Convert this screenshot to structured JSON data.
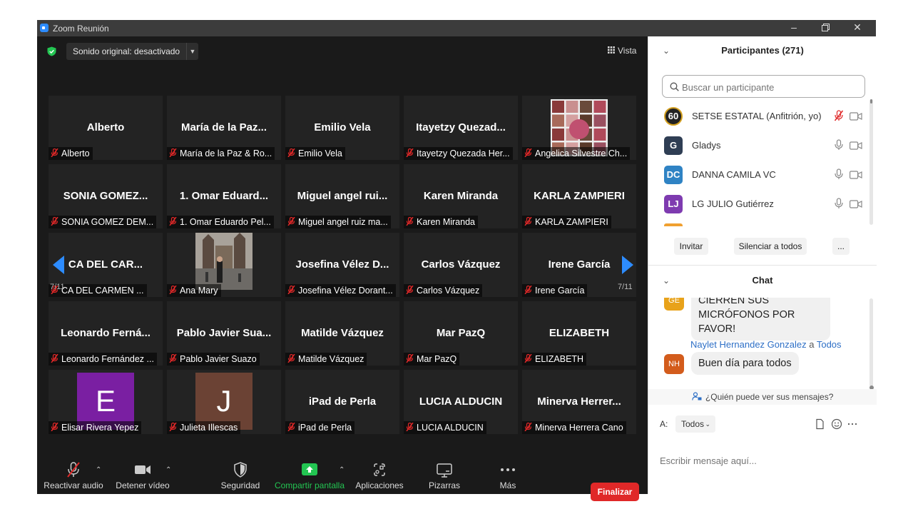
{
  "window": {
    "title": "Zoom Reunión"
  },
  "header": {
    "audio_label": "Sonido original: desactivado",
    "view_label": "Vista"
  },
  "grid": {
    "rows": [
      [
        {
          "name": "Alberto",
          "label": "Alberto"
        },
        {
          "name": "María de la Paz...",
          "label": "María de la Paz & Ro..."
        },
        {
          "name": "Emilio Vela",
          "label": "Emilio Vela"
        },
        {
          "name": "Itayetzy  Quezad...",
          "label": "Itayetzy Quezada Her..."
        },
        {
          "name": "",
          "label": "Angelica Silvestre Ch...",
          "media": "photo-collage"
        }
      ],
      [
        {
          "name": "SONIA  GOMEZ...",
          "label": "SONIA GOMEZ DEM..."
        },
        {
          "name": "1. Omar  Eduard...",
          "label": "1. Omar Eduardo Pel..."
        },
        {
          "name": "Miguel angel rui...",
          "label": "Miguel angel ruiz ma..."
        },
        {
          "name": "Karen Miranda",
          "label": "Karen Miranda"
        },
        {
          "name": "KARLA ZAMPIERI",
          "label": "KARLA ZAMPIERI"
        }
      ],
      [
        {
          "name": "CA DEL CAR...",
          "label": "CA DEL CARMEN ..."
        },
        {
          "name": "",
          "label": "Ana Mary",
          "media": "photo-street"
        },
        {
          "name": "Josefina Vélez D...",
          "label": "Josefina Vélez Dorant..."
        },
        {
          "name": "Carlos Vázquez",
          "label": "Carlos Vázquez"
        },
        {
          "name": "Irene García",
          "label": "Irene García"
        }
      ],
      [
        {
          "name": "Leonardo  Ferná...",
          "label": "Leonardo Fernández ..."
        },
        {
          "name": "Pablo Javier Sua...",
          "label": "Pablo Javier Suazo"
        },
        {
          "name": "Matilde Vázquez",
          "label": "Matilde Vázquez"
        },
        {
          "name": "Mar PazQ",
          "label": "Mar PazQ"
        },
        {
          "name": "ELIZABETH",
          "label": "ELIZABETH"
        }
      ],
      [
        {
          "name": "",
          "label": "Elisar Rivera Yepez",
          "avatar": "E",
          "avatar_color": "#7a1fa2"
        },
        {
          "name": "",
          "label": "Julieta Illescas",
          "avatar": "J",
          "avatar_color": "#6b4234"
        },
        {
          "name": "iPad de Perla",
          "label": "iPad de Perla"
        },
        {
          "name": "LUCIA ALDUCIN",
          "label": "LUCIA ALDUCIN"
        },
        {
          "name": "Minerva  Herrer...",
          "label": "Minerva Herrera Cano"
        }
      ]
    ],
    "page_left": "7/11",
    "page_right": "7/11"
  },
  "toolbar": {
    "unmute": "Reactivar audio",
    "stop_video": "Detener vídeo",
    "security": "Seguridad",
    "share": "Compartir pantalla",
    "apps": "Aplicaciones",
    "whiteboard": "Pizarras",
    "more": "Más",
    "end": "Finalizar"
  },
  "participants": {
    "header": "Participantes (271)",
    "search_placeholder": "Buscar un participante",
    "list": [
      {
        "name": "SETSE ESTATAL (Anfitrión, yo)",
        "avatar": "60",
        "color": "#222222",
        "muted": true
      },
      {
        "name": "Gladys",
        "avatar": "G",
        "color": "#2f3e54",
        "muted": false
      },
      {
        "name": "DANNA CAMILA VC",
        "avatar": "DC",
        "color": "#2f83c4",
        "muted": false
      },
      {
        "name": "LG JULIO Gutiérrez",
        "avatar": "LJ",
        "color": "#7e3bb0",
        "muted": false
      }
    ],
    "invite": "Invitar",
    "mute_all": "Silenciar a todos",
    "more": "..."
  },
  "chat": {
    "header": "Chat",
    "msg1": {
      "avatar": "GE",
      "text_line1": "CIERREN SUS",
      "text_line2": "MICRÓFONOS POR FAVOR!"
    },
    "msg2": {
      "sender": "Naylet Hernandez Gonzalez",
      "to_word": "a",
      "to": "Todos",
      "avatar": "NH",
      "text": "Buen día para todos"
    },
    "who_can_see": "¿Quién puede ver sus mensajes?",
    "to_label": "A:",
    "to_value": "Todos",
    "input_placeholder": "Escribir mensaje aquí..."
  }
}
